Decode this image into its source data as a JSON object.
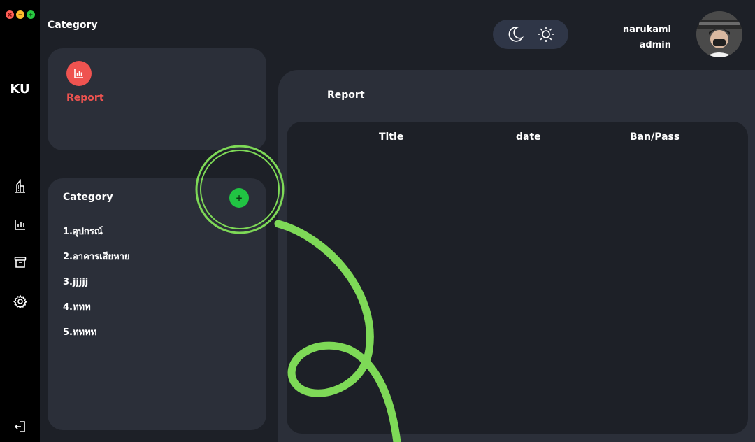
{
  "window": {
    "traffic_lights": [
      "close",
      "minimize",
      "maximize"
    ]
  },
  "sidebar": {
    "brand": "KU",
    "icons": [
      "building-icon",
      "chart-icon",
      "archive-icon",
      "gear-icon",
      "logout-icon"
    ]
  },
  "header": {
    "title": "Category",
    "theme_toggle": {
      "dark_icon": "moon-icon",
      "light_icon": "sun-icon"
    },
    "user": {
      "name": "narukami",
      "role": "admin"
    }
  },
  "report_card": {
    "label": "Report",
    "value": "--",
    "icon": "chart-icon",
    "accent": "#ef5350"
  },
  "category_card": {
    "title": "Category",
    "add_label": "+",
    "items": [
      "1.อุปกรณ์",
      "2.อาคารเสียหาย",
      "3.jjjjj",
      "4.ททท",
      "5.ทททท"
    ]
  },
  "report_panel": {
    "title": "Report",
    "columns": [
      "Title",
      "date",
      "Ban/Pass"
    ]
  },
  "colors": {
    "background": "#1d2027",
    "card": "#2b2f39",
    "sidebar": "#000000",
    "add_button": "#21c443",
    "annotation": "#7ed957"
  }
}
